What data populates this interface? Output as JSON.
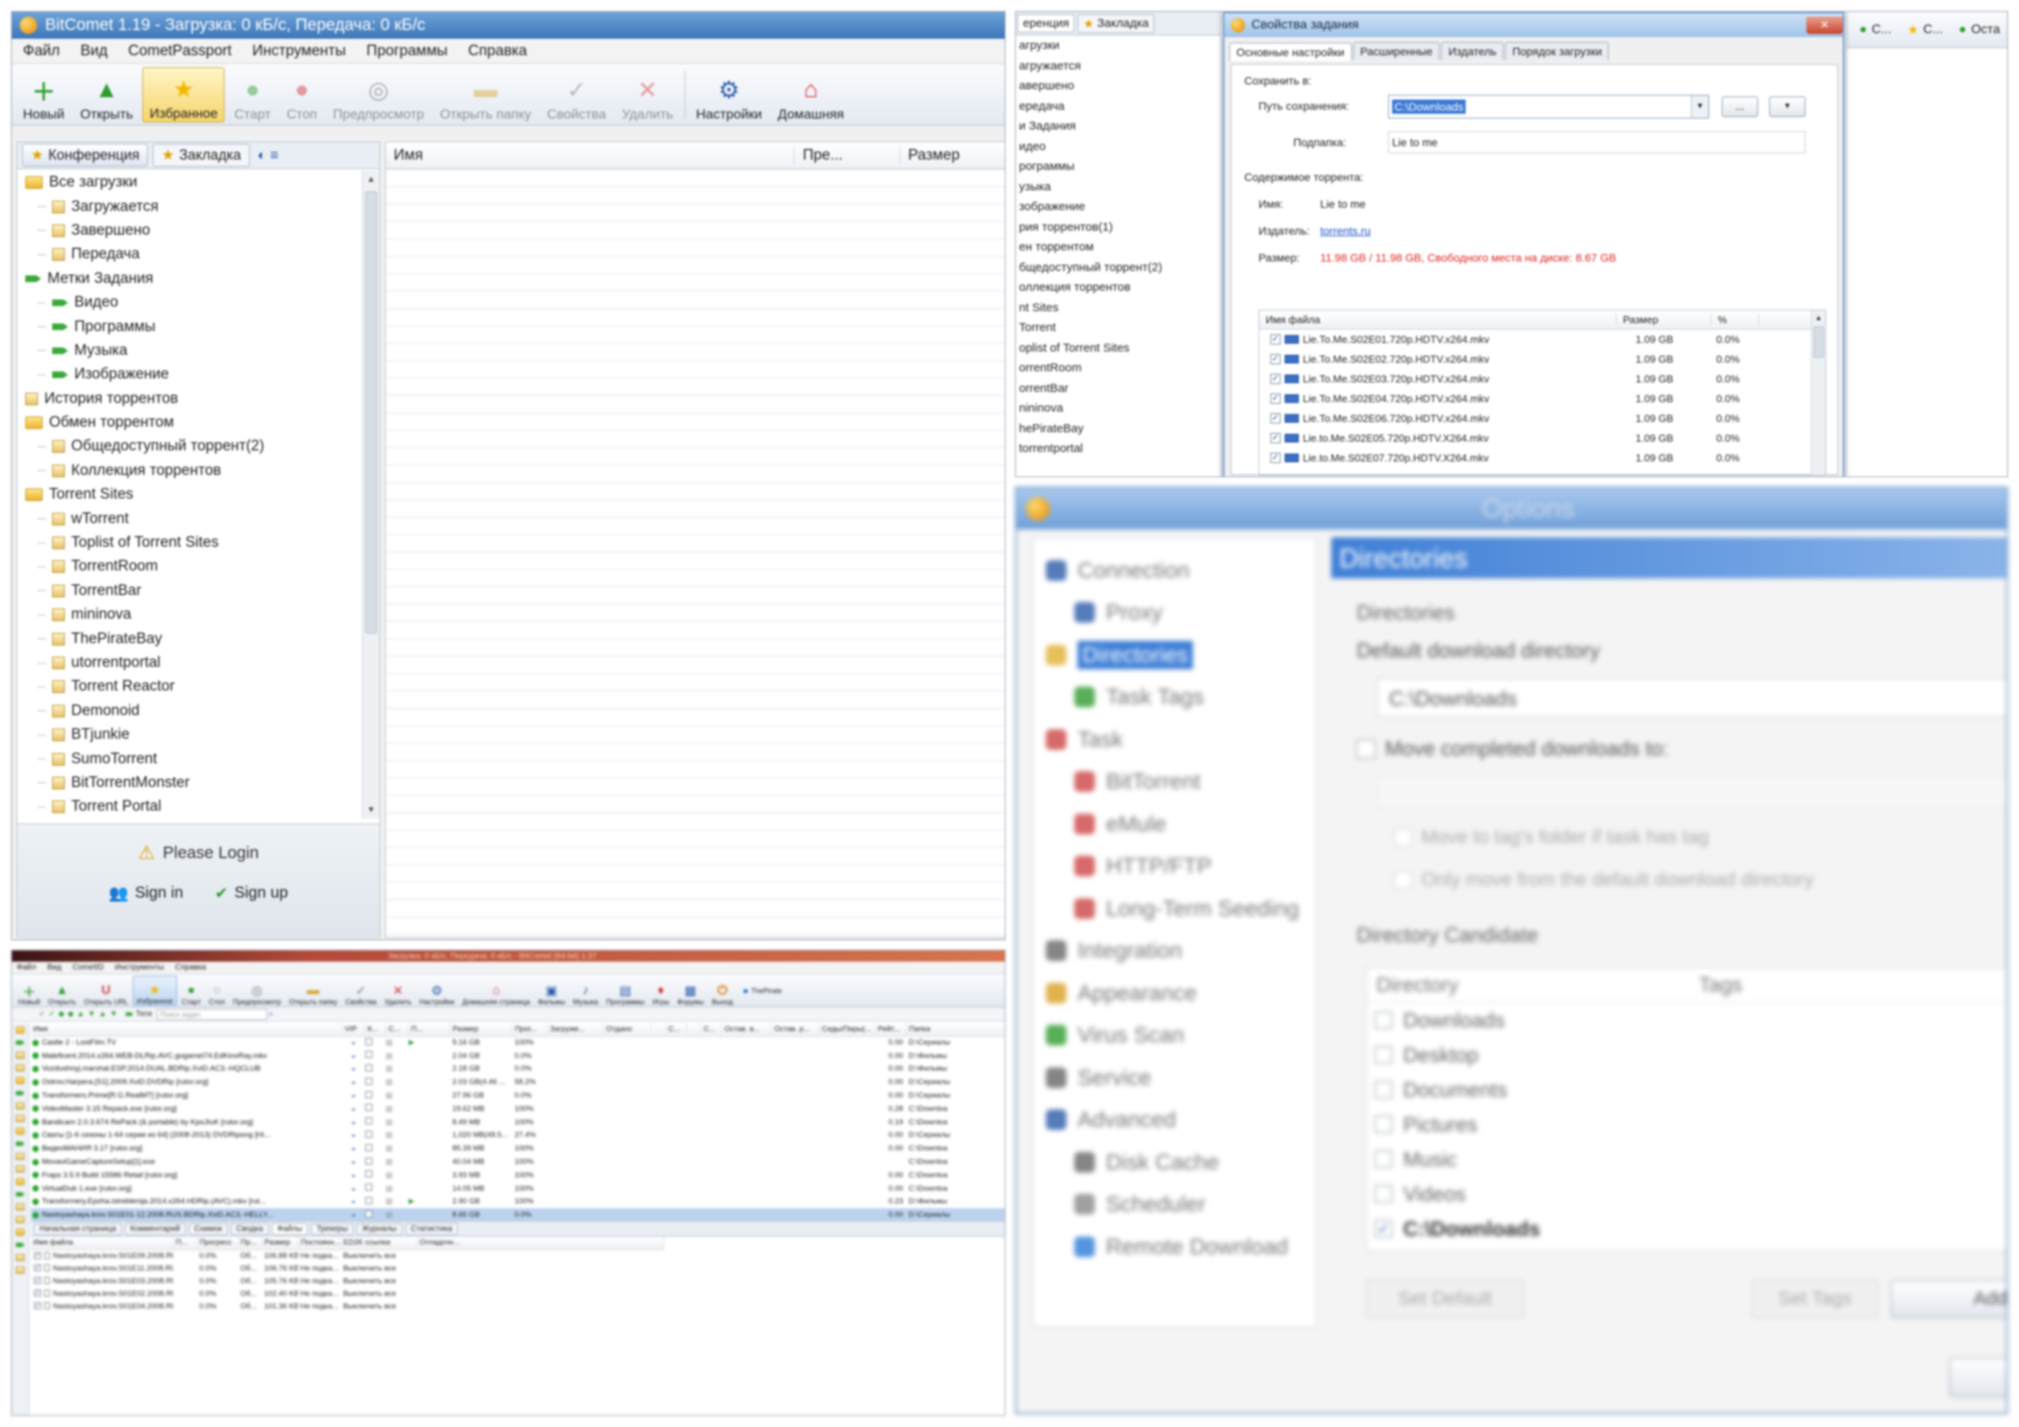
{
  "panel1": {
    "title": "BitComet 1.19 - Загрузка: 0 кБ/с, Передача: 0 кБ/с",
    "menu": [
      "Файл",
      "Вид",
      "CometPassport",
      "Инструменты",
      "Программы",
      "Справка"
    ],
    "toolbar": [
      {
        "label": "Новый",
        "icon": "new-icon",
        "color": "#2e9b2e",
        "glyph": "＋",
        "enabled": true
      },
      {
        "label": "Открыть",
        "icon": "open-icon",
        "color": "#2e9b2e",
        "glyph": "▲",
        "enabled": true
      },
      {
        "label": "Избранное",
        "icon": "star-icon",
        "color": "#f2b800",
        "glyph": "★",
        "enabled": true,
        "active": true
      },
      {
        "label": "Старт",
        "icon": "start-icon",
        "color": "#2e9b2e",
        "glyph": "●",
        "enabled": false
      },
      {
        "label": "Стоп",
        "icon": "stop-icon",
        "color": "#d63030",
        "glyph": "●",
        "enabled": false
      },
      {
        "label": "Предпросмотр",
        "icon": "preview-icon",
        "color": "#555",
        "glyph": "◎",
        "enabled": false
      },
      {
        "label": "Открыть папку",
        "icon": "folder-icon",
        "color": "#d6a530",
        "glyph": "▬",
        "enabled": false
      },
      {
        "label": "Свойства",
        "icon": "properties-icon",
        "color": "#777",
        "glyph": "✓",
        "enabled": false
      },
      {
        "label": "Удалить",
        "icon": "delete-icon",
        "color": "#d63030",
        "glyph": "✕",
        "enabled": false
      },
      {
        "label": "Настройки",
        "icon": "settings-icon",
        "color": "#2a5aa8",
        "glyph": "⚙",
        "enabled": true
      },
      {
        "label": "Домашняя",
        "icon": "home-icon",
        "color": "#d63030",
        "glyph": "⌂",
        "enabled": true
      }
    ],
    "left_tabs": [
      "Конференция",
      "Закладка"
    ],
    "tree": [
      {
        "label": "Все загрузки",
        "level": 0,
        "icon": "folder"
      },
      {
        "label": "Загружается",
        "level": 1,
        "icon": "flag"
      },
      {
        "label": "Завершено",
        "level": 1,
        "icon": "flag"
      },
      {
        "label": "Передача",
        "level": 1,
        "icon": "flag"
      },
      {
        "label": "Метки Задания",
        "level": 0,
        "icon": "tag"
      },
      {
        "label": "Видео",
        "level": 1,
        "icon": "tag"
      },
      {
        "label": "Программы",
        "level": 1,
        "icon": "tag"
      },
      {
        "label": "Музыка",
        "level": 1,
        "icon": "tag"
      },
      {
        "label": "Изображение",
        "level": 1,
        "icon": "tag"
      },
      {
        "label": "История торрентов",
        "level": 0,
        "icon": "flag"
      },
      {
        "label": "Обмен торрентом",
        "level": 0,
        "icon": "folder"
      },
      {
        "label": "Общедоступный торрент(2)",
        "level": 1,
        "icon": "flag"
      },
      {
        "label": "Коллекция торрентов",
        "level": 1,
        "icon": "flag"
      },
      {
        "label": "Torrent Sites",
        "level": 0,
        "icon": "folder"
      },
      {
        "label": "wTorrent",
        "level": 1,
        "icon": "flag"
      },
      {
        "label": "Toplist of Torrent Sites",
        "level": 1,
        "icon": "flag"
      },
      {
        "label": "TorrentRoom",
        "level": 1,
        "icon": "flag"
      },
      {
        "label": "TorrentBar",
        "level": 1,
        "icon": "flag"
      },
      {
        "label": "mininova",
        "level": 1,
        "icon": "flag"
      },
      {
        "label": "ThePirateBay",
        "level": 1,
        "icon": "flag"
      },
      {
        "label": "utorrentportal",
        "level": 1,
        "icon": "flag"
      },
      {
        "label": "Torrent Reactor",
        "level": 1,
        "icon": "flag"
      },
      {
        "label": "Demonoid",
        "level": 1,
        "icon": "flag"
      },
      {
        "label": "BTjunkie",
        "level": 1,
        "icon": "flag"
      },
      {
        "label": "SumoTorrent",
        "level": 1,
        "icon": "flag"
      },
      {
        "label": "BitTorrentMonster",
        "level": 1,
        "icon": "flag"
      },
      {
        "label": "Torrent Portal",
        "level": 1,
        "icon": "flag"
      }
    ],
    "please_login": "Please Login",
    "sign_in": "Sign in",
    "sign_up": "Sign up",
    "columns": [
      "Имя",
      "Пре...",
      "Размер"
    ]
  },
  "panel2": {
    "left_tabs": [
      "еренция",
      "Закладка"
    ],
    "left_tree": [
      "агрузки",
      "агружается",
      "авершено",
      "ередача",
      "и Задания",
      "идео",
      "рограммы",
      "узыка",
      "зображение",
      "рия торрентов(1)",
      "ен торрентом",
      "бщедоступный торрент(2)",
      "оллекция торрентов",
      "nt Sites",
      "Torrent",
      "oplist of Torrent Sites",
      "orrentRoom",
      "orrentBar",
      "nininova",
      "hePirateBay",
      "torrentportal"
    ],
    "dialog_title": "Свойства задания",
    "tabs": [
      "Основные настройки",
      "Расширенные",
      "Издатель",
      "Порядок загрузки"
    ],
    "save_group": "Сохранить в:",
    "path_label": "Путь сохранения:",
    "path_value": "C:\\Downloads",
    "browse_btn": "...",
    "subfolder_label": "Подпапка:",
    "subfolder_value": "Lie to me",
    "content_group": "Содержимое торрента:",
    "name_label": "Имя:",
    "name_value": "Lie to me",
    "publisher_label": "Издатель:",
    "publisher_value": "torrents.ru",
    "size_label": "Размер:",
    "size_value": "11.98 GB / 11.98 GB, Свободного места на диске: 8.67 GB",
    "file_cols": [
      "Имя файла",
      "Размер",
      "%"
    ],
    "files": [
      {
        "name": "Lie.To.Me.S02E01.720p.HDTV.x264.mkv",
        "size": "1.09 GB",
        "pct": "0.0%"
      },
      {
        "name": "Lie.To.Me.S02E02.720p.HDTV.x264.mkv",
        "size": "1.09 GB",
        "pct": "0.0%"
      },
      {
        "name": "Lie.To.Me.S02E03.720p.HDTV.x264.mkv",
        "size": "1.09 GB",
        "pct": "0.0%"
      },
      {
        "name": "Lie.To.Me.S02E04.720p.HDTV.x264.mkv",
        "size": "1.09 GB",
        "pct": "0.0%"
      },
      {
        "name": "Lie.To.Me.S02E06.720p.HDTV.x264.mkv",
        "size": "1.09 GB",
        "pct": "0.0%"
      },
      {
        "name": "Lie.to.Me.S02E05.720p.HDTV.X264.mkv",
        "size": "1.09 GB",
        "pct": "0.0%"
      },
      {
        "name": "Lie.to.Me.S02E07.720p.HDTV.X264.mkv",
        "size": "1.09 GB",
        "pct": "0.0%"
      }
    ],
    "right_strip": [
      "С...",
      "С...",
      "Оста"
    ]
  },
  "panel3": {
    "title": "Options",
    "tree": [
      {
        "label": "Connection",
        "level": 0,
        "color": "#2a5aa8"
      },
      {
        "label": "Proxy",
        "level": 1,
        "color": "#2a5aa8"
      },
      {
        "label": "Directories",
        "level": 0,
        "color": "#e0b030",
        "selected": true
      },
      {
        "label": "Task Tags",
        "level": 1,
        "color": "#2e9b2e"
      },
      {
        "label": "Task",
        "level": 0,
        "color": "#c44"
      },
      {
        "label": "BitTorrent",
        "level": 1,
        "color": "#c44"
      },
      {
        "label": "eMule",
        "level": 1,
        "color": "#c44"
      },
      {
        "label": "HTTP/FTP",
        "level": 1,
        "color": "#c44"
      },
      {
        "label": "Long-Term Seeding",
        "level": 1,
        "color": "#c44"
      },
      {
        "label": "Integration",
        "level": 0,
        "color": "#666"
      },
      {
        "label": "Appearance",
        "level": 0,
        "color": "#d8a020"
      },
      {
        "label": "Virus Scan",
        "level": 0,
        "color": "#2e9b2e"
      },
      {
        "label": "Service",
        "level": 0,
        "color": "#666"
      },
      {
        "label": "Advanced",
        "level": 0,
        "color": "#2a5aa8"
      },
      {
        "label": "Disk Cache",
        "level": 1,
        "color": "#666"
      },
      {
        "label": "Scheduler",
        "level": 1,
        "color": "#888"
      },
      {
        "label": "Remote Download",
        "level": 1,
        "color": "#2a7ad8"
      }
    ],
    "header": "Directories",
    "group": "Directories",
    "default_dir_label": "Default download directory",
    "default_dir_value": "C:\\Downloads",
    "move_completed": "Move completed downloads to:",
    "move_tag": "Move to tag's folder if task has tag",
    "only_move": "Only move from the default download directory",
    "candidate_group": "Directory Candidate",
    "cand_cols": [
      "Directory",
      "Tags"
    ],
    "candidates": [
      {
        "label": "Downloads",
        "checked": false
      },
      {
        "label": "Desktop",
        "checked": false
      },
      {
        "label": "Documents",
        "checked": false
      },
      {
        "label": "Pictures",
        "checked": false
      },
      {
        "label": "Music",
        "checked": false
      },
      {
        "label": "Videos",
        "checked": false
      },
      {
        "label": "C:\\Downloads",
        "checked": true
      }
    ],
    "set_default": "Set Default",
    "set_tags": "Set Tags",
    "add": "Add"
  },
  "panel4": {
    "title": "Загрузка: 0 кБ/с, Передача: 0 кБ/с - BitComet (64-bit) 1.37",
    "menu": [
      "Файл",
      "Вид",
      "CometID",
      "Инструменты",
      "Справка"
    ],
    "toolbar": [
      {
        "label": "Новый",
        "color": "#2e9b2e",
        "glyph": "＋"
      },
      {
        "label": "Открыть",
        "color": "#2e9b2e",
        "glyph": "▲"
      },
      {
        "label": "Открыть URL",
        "color": "#c44",
        "glyph": "U"
      },
      {
        "label": "Избранное",
        "color": "#f2b800",
        "glyph": "★",
        "active": true
      },
      {
        "label": "Старт",
        "color": "#2e9b2e",
        "glyph": "●"
      },
      {
        "label": "Стоп",
        "color": "#999",
        "glyph": "○"
      },
      {
        "label": "Предпросмотр",
        "color": "#777",
        "glyph": "◎"
      },
      {
        "label": "Открыть папку",
        "color": "#d6a530",
        "glyph": "▬"
      },
      {
        "label": "Свойства",
        "color": "#777",
        "glyph": "✓"
      },
      {
        "label": "Удалить",
        "color": "#d63030",
        "glyph": "✕"
      },
      {
        "label": "Настройки",
        "color": "#2a5aa8",
        "glyph": "⚙"
      },
      {
        "label": "Домашняя страница",
        "color": "#d63030",
        "glyph": "⌂"
      },
      {
        "label": "Фильмы",
        "color": "#2a5aa8",
        "glyph": "▣"
      },
      {
        "label": "Музыка",
        "color": "#2a5aa8",
        "glyph": "♪"
      },
      {
        "label": "Программы",
        "color": "#2a5aa8",
        "glyph": "▤"
      },
      {
        "label": "Игры",
        "color": "#d63030",
        "glyph": "♦"
      },
      {
        "label": "Форумы",
        "color": "#2a5aa8",
        "glyph": "▦"
      },
      {
        "label": "Выход",
        "color": "#e07000",
        "glyph": "⏻"
      }
    ],
    "brand": "ThePirate",
    "tags_label": "Теги",
    "search_placeholder": "Поиск задач",
    "columns": [
      "Имя",
      "VIP",
      "К...",
      "С...",
      "П...",
      "Размер",
      "Прог...",
      "Загруже...",
      "Отдано",
      "",
      "С...",
      "",
      "С...",
      "Остав. в...",
      "Остав. р...",
      "Сиды/Пиры(...",
      "Рейт...",
      "Папка"
    ],
    "rows": [
      {
        "name": "Castle 2 - LostFilm.TV",
        "size": "9.16 GB",
        "progress": "100%",
        "ratio": "0.00",
        "folder": "D:\\Сериалы",
        "play": true
      },
      {
        "name": "Maleficent.2014.x264.WEB-DLRip.AVC.gogamel74.EdKinoRay.mkv",
        "size": "2.04 GB",
        "progress": "0.0%",
        "ratio": "0.00",
        "folder": "D:\\Фильмы",
        "play": false
      },
      {
        "name": "Vozdushnyj.marshal.ESP.2014.DUAL.BDRip.XviD.AC3.-HQCLUB",
        "size": "2.18 GB",
        "progress": "0.0%",
        "ratio": "0.00",
        "folder": "D:\\Фильмы",
        "play": false
      },
      {
        "name": "Ostrov.Harpera.[S1].2009.XviD.DVDRip [rutor.org]",
        "size": "2.03 GB(4.46 ...",
        "progress": "58.2%",
        "ratio": "0.00",
        "folder": "D:\\Сериалы",
        "play": false
      },
      {
        "name": "Transformers.Prime[R.G.RealMT] [rutor.org]",
        "size": "27.96 GB",
        "progress": "0.0%",
        "ratio": "0.00",
        "folder": "D:\\Сериалы",
        "play": false
      },
      {
        "name": "VideoMaster 3.15 Repack.exe [rutor.org]",
        "size": "19.62 MB",
        "progress": "100%",
        "ratio": "0.28",
        "folder": "C:\\Downloa",
        "play": false
      },
      {
        "name": "Bandicam 2.0.3.674 RePack (& portable) by KpoJIuK [rutor.org]",
        "size": "8.49 MB",
        "progress": "100%",
        "ratio": "0.19",
        "folder": "C:\\Downloa",
        "play": false
      },
      {
        "name": "Сваты [1-6 сезоны 1-64 серии из 64] (2008-2013) DVDRipong [Hi...",
        "size": "1,020 MB(48.5...",
        "progress": "27.4%",
        "ratio": "0.00",
        "folder": "D:\\Сериалы",
        "play": false
      },
      {
        "name": "ВидеоМАНИЯ 3.17 [rutor.org]",
        "size": "85.39 MB",
        "progress": "100%",
        "ratio": "0.00",
        "folder": "C:\\Downloa",
        "play": false
      },
      {
        "name": "MovaviGameCaptureSetup[1].exe",
        "size": "40.04 MB",
        "progress": "100%",
        "ratio": "",
        "folder": "C:\\Downloa",
        "play": false
      },
      {
        "name": "Fraps 3.5.9 Build 15586 Retail [rutor.org]",
        "size": "3.93 MB",
        "progress": "100%",
        "ratio": "0.00",
        "folder": "C:\\Downloa",
        "play": false
      },
      {
        "name": "VirtualDub 1.exe [rutor.org]",
        "size": "14.05 MB",
        "progress": "100%",
        "ratio": "0.00",
        "folder": "C:\\Downloa",
        "play": false
      },
      {
        "name": "Transformery.Epoha.istreblenija.2014.x264.HDRip.(AVC).mkv [rut...",
        "size": "2.90 GB",
        "progress": "100%",
        "ratio": "0.23",
        "folder": "D:\\Фильмы",
        "play": true
      },
      {
        "name": "Nastoyashaya.krov.S01E01-12.2008.RUS.BDRip.XviD.AC3.-HELLY...",
        "size": "8.66 GB",
        "progress": "0.0%",
        "ratio": "0.00",
        "folder": "D:\\Сериалы",
        "play": false,
        "selected": true
      }
    ],
    "bottom_tabs": [
      "Начальная страница",
      "Комментарий",
      "Снимок",
      "Сводка",
      "Файлы",
      "Трекеры",
      "Журналы",
      "Статистика"
    ],
    "file_columns": [
      "Имя файла",
      "П...",
      "Прогресс",
      "Пр...",
      "Размер",
      "Постоянн...",
      "ED2K ссылка",
      "Отладочн..."
    ],
    "files": [
      {
        "name": "Nastoyashaya.krov.S01E09.2008.RUS.BDRip.Xvi...",
        "progress": "0.0%",
        "pr": "Об...",
        "size": "106.88 KB",
        "perm": "Не подка...",
        "ed2k": "Выключить все"
      },
      {
        "name": "Nastoyashaya.krov.S01E11.2008.RUS.BDRip.Xvi...",
        "progress": "0.0%",
        "pr": "Об...",
        "size": "106.76 KB",
        "perm": "Не подка...",
        "ed2k": "Выключить все"
      },
      {
        "name": "Nastoyashaya.krov.S01E03.2008.RUS.BDRip.Xvi...",
        "progress": "0.0%",
        "pr": "Об...",
        "size": "105.76 KB",
        "perm": "Не подка...",
        "ed2k": "Выключить все"
      },
      {
        "name": "Nastoyashaya.krov.S01E02.2008.RUS.BDRip.Xvi...",
        "progress": "0.0%",
        "pr": "Об...",
        "size": "102.40 KB",
        "perm": "Не подка...",
        "ed2k": "Выключить все"
      },
      {
        "name": "Nastoyashaya.krov.S01E04.2008.RUS.BDRip.Xvi...",
        "progress": "0.0%",
        "pr": "Об...",
        "size": "101.36 KB",
        "perm": "Не подка...",
        "ed2k": "Выключить все"
      }
    ]
  }
}
